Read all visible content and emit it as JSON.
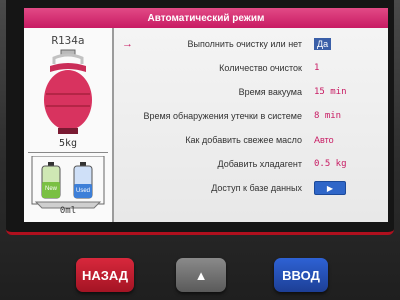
{
  "screen": {
    "title": "Автоматический режим"
  },
  "left_panel": {
    "refrigerant": "R134a",
    "tank_weight": "5kg",
    "bottles": [
      {
        "label": "New",
        "color": "#7ac043"
      },
      {
        "label": "Used",
        "color": "#3d7fd8"
      }
    ],
    "scale_reading": "0ml"
  },
  "settings": {
    "selected_marker": "→",
    "rows": [
      {
        "label": "Выполнить очистку или нет",
        "value": "Да"
      },
      {
        "label": "Количество очисток",
        "value": "1"
      },
      {
        "label": "Время вакуума",
        "value": "15 min"
      },
      {
        "label": "Время обнаружения утечки в системе",
        "value": "8 min"
      },
      {
        "label": "Как добавить свежее масло",
        "value": "Авто"
      },
      {
        "label": "Добавить хладагент",
        "value": "0.5 kg"
      },
      {
        "label": "Доступ к базе данных",
        "value": "▶"
      }
    ]
  },
  "hardware_buttons": {
    "back": "НАЗАД",
    "up": "▲",
    "enter": "ВВОД"
  },
  "colors": {
    "accent": "#c81b63",
    "selection": "#3a5fa8",
    "cylinder": "#d8335f"
  }
}
